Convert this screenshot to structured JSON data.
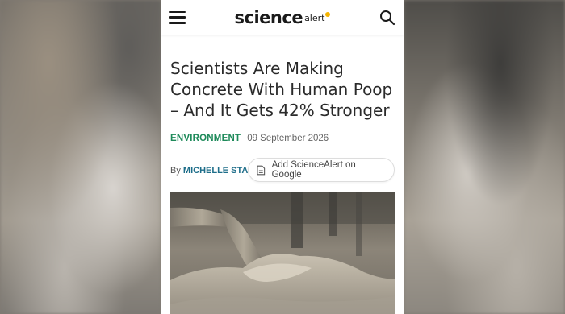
{
  "header": {
    "logo_main": "science",
    "logo_alert": "alert"
  },
  "article": {
    "headline": "Scientists Are Making Concrete With Human Poop – And It Gets 42% Stronger",
    "category": "ENVIRONMENT",
    "date": "09 September 2026",
    "byline_prefix": "By",
    "author": "MICHELLE STARR",
    "google_button_label": "Add ScienceAlert on Google"
  },
  "icons": [
    "menu-icon",
    "search-icon",
    "document-icon"
  ],
  "colors": {
    "category": "#1e8a5a",
    "author": "#1e6e8a",
    "logo_dot": "#f5b400"
  }
}
